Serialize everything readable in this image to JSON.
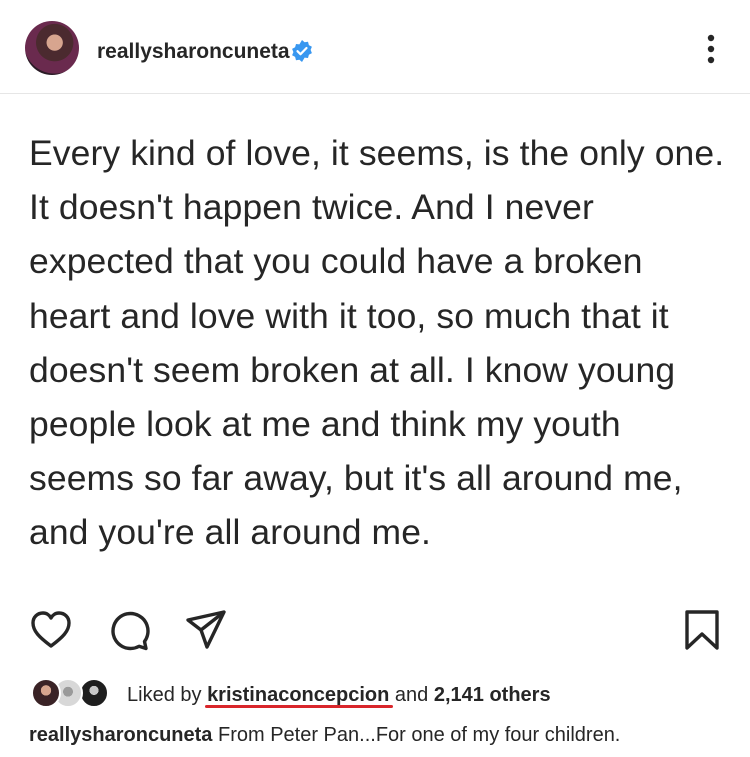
{
  "post": {
    "username": "reallysharoncuneta",
    "body_text": "Every kind of love, it seems, is the only one. It doesn't happen twice. And I never expected that you could have a broken heart and love with it too, so much that it doesn't seem broken at all. I know young people look at me and think my youth seems so far away, but it's all around me, and you're all around me."
  },
  "likes": {
    "prefix": "Liked by",
    "liker": "kristinaconcepcion",
    "and": "and",
    "others": "2,141 others"
  },
  "caption": {
    "username": "reallysharoncuneta",
    "text": "From Peter Pan...For one of my four children."
  },
  "icons": {
    "verified": "verified-badge-icon",
    "more": "more-options-icon",
    "like": "heart-icon",
    "comment": "comment-icon",
    "share": "send-icon",
    "save": "bookmark-icon"
  },
  "colors": {
    "verified_blue": "#3897f0",
    "annotation_red": "#d9262b",
    "text": "#262626"
  }
}
